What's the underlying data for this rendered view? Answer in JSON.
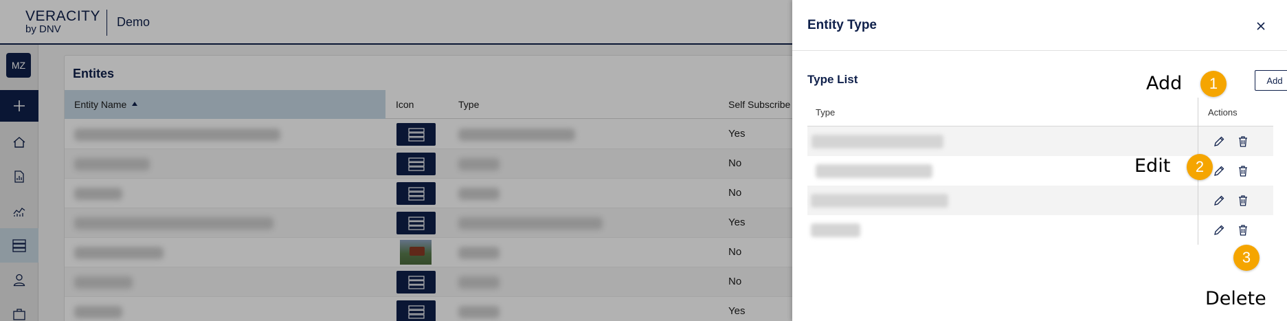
{
  "header": {
    "logo_line1": "VERACITY",
    "logo_line2": "by DNV",
    "app_name": "Demo"
  },
  "sidenav": {
    "avatar_initials": "MZ",
    "items": [
      {
        "icon": "plus-icon"
      },
      {
        "icon": "home-icon"
      },
      {
        "icon": "report-icon"
      },
      {
        "icon": "analytics-icon"
      },
      {
        "icon": "entities-icon",
        "active": true
      },
      {
        "icon": "user-icon"
      },
      {
        "icon": "briefcase-icon"
      }
    ]
  },
  "entities": {
    "title": "Entites",
    "columns": {
      "entity_name": "Entity Name",
      "icon": "Icon",
      "type": "Type",
      "self_subscribe": "Self Subscribe"
    },
    "rows": [
      {
        "self_subscribe": "Yes",
        "icon": "server-icon"
      },
      {
        "self_subscribe": "No",
        "icon": "server-icon"
      },
      {
        "self_subscribe": "No",
        "icon": "server-icon"
      },
      {
        "self_subscribe": "Yes",
        "icon": "server-icon"
      },
      {
        "self_subscribe": "No",
        "icon": "photo-thumbnail"
      },
      {
        "self_subscribe": "No",
        "icon": "server-icon"
      },
      {
        "self_subscribe": "Yes",
        "icon": "server-icon"
      }
    ]
  },
  "drawer": {
    "title": "Entity Type",
    "close_icon": "close-icon",
    "section_title": "Type List",
    "add_label": "Add",
    "columns": {
      "type": "Type",
      "actions": "Actions"
    },
    "row_count": 4
  },
  "callouts": {
    "add": {
      "number": "1",
      "label": "Add"
    },
    "edit": {
      "number": "2",
      "label": "Edit"
    },
    "delete": {
      "number": "3",
      "label": "Delete"
    }
  },
  "colors": {
    "brand_navy": "#0f204b",
    "sorted_header": "#c7d9e5",
    "callout_orange": "#f5a500"
  }
}
